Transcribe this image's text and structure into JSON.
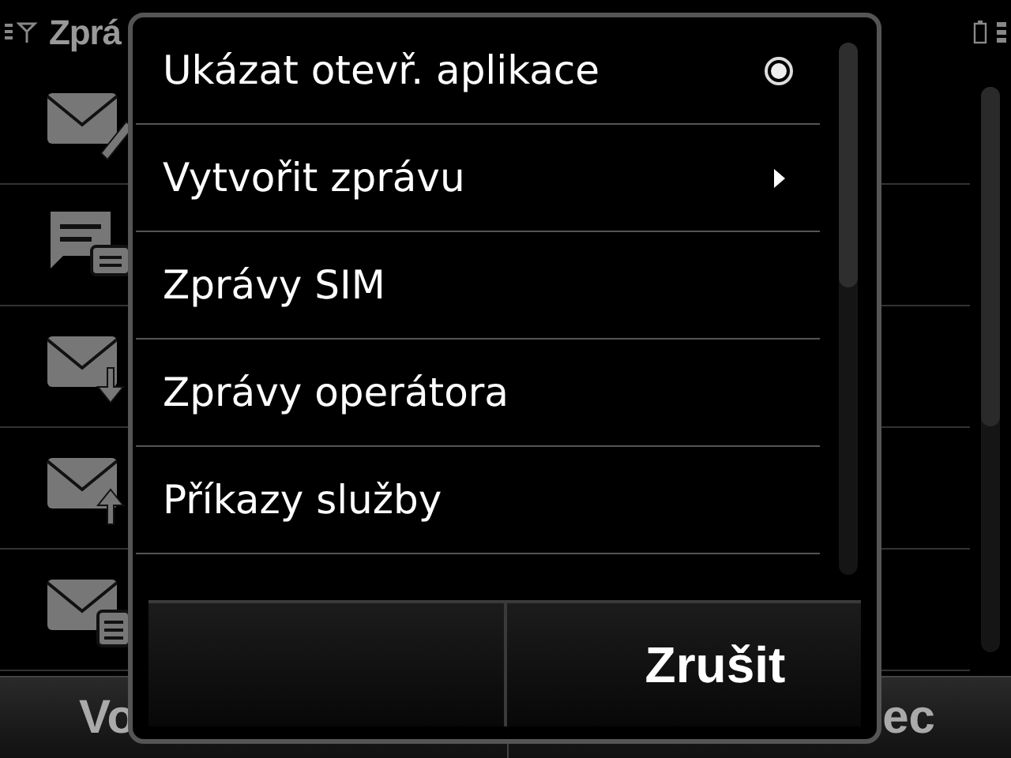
{
  "status_bar": {
    "title": "Zprá"
  },
  "background_list": [
    {
      "kind": "compose"
    },
    {
      "kind": "chat"
    },
    {
      "kind": "inbox"
    },
    {
      "kind": "outbox"
    },
    {
      "kind": "drafts"
    }
  ],
  "softkeys": {
    "left": "Vo",
    "right": "ec"
  },
  "menu": {
    "items": [
      {
        "label": "Ukázat otevř. aplikace",
        "kind": "radio",
        "checked": true
      },
      {
        "label": "Vytvořit zprávu",
        "kind": "submenu"
      },
      {
        "label": "Zprávy SIM",
        "kind": "plain"
      },
      {
        "label": "Zprávy operátora",
        "kind": "plain"
      },
      {
        "label": "Příkazy služby",
        "kind": "plain"
      }
    ],
    "buttons": [
      {
        "kind": "blank"
      },
      {
        "kind": "cancel",
        "label": "Zrušit"
      }
    ]
  }
}
